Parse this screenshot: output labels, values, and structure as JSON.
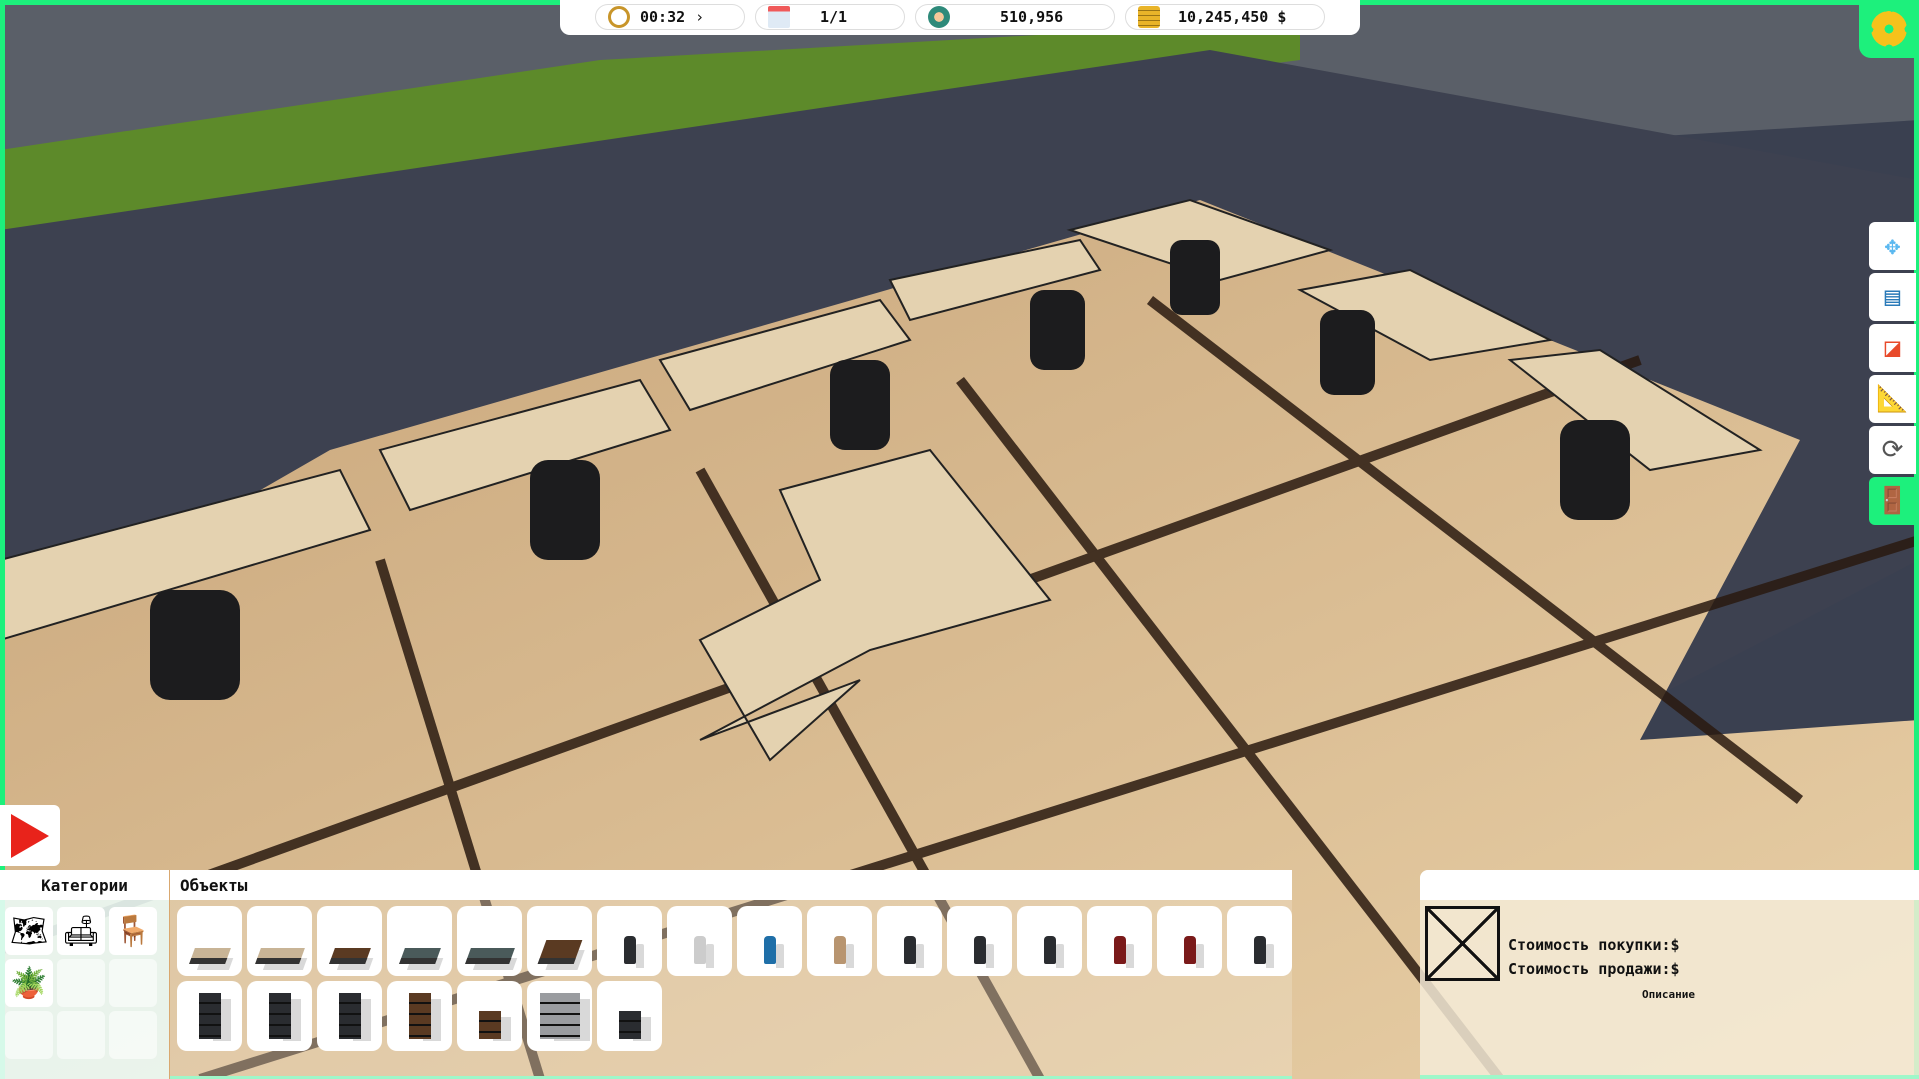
{
  "hud": {
    "time": "00:32",
    "date": "1/1",
    "population": "510,956",
    "money": "10,245,450 $"
  },
  "hud_icons": [
    "clock-icon",
    "chevron-right-icon",
    "calendar-icon",
    "worker-icon",
    "coins-icon"
  ],
  "tools": [
    "move-icon",
    "documents-icon",
    "eraser-icon",
    "blueprint-icon",
    "rotate-floor-icon",
    "door-exit-icon"
  ],
  "categories": {
    "title": "Категории",
    "items": [
      "floor-plan",
      "furniture-lounge",
      "office-desk-chair",
      "plants"
    ]
  },
  "objects": {
    "title": "Объекты",
    "row1": [
      "desk-light",
      "corner-desk-light",
      "desk-dark-wood",
      "desk-glass-black",
      "corner-desk-glass",
      "reception-desk",
      "chair-metal",
      "office-chair-white",
      "office-chair-blue",
      "office-chair-beige",
      "office-chair-black",
      "office-chair-black-high",
      "office-chair-black-2",
      "office-chair-red",
      "chair-red",
      "gaming-chair"
    ],
    "row2": [
      "shelf-dark",
      "shelf-industrial",
      "shelf-metal",
      "bookcase-wood",
      "bookcase-small",
      "cube-shelf-grey",
      "side-shelf"
    ]
  },
  "info": {
    "buy_price": "Стоимость покупки:$",
    "sell_price": "Стоимость продажи:$",
    "description": "Описание"
  },
  "colors": {
    "accent": "#1df07c",
    "play": "#e8231b"
  }
}
